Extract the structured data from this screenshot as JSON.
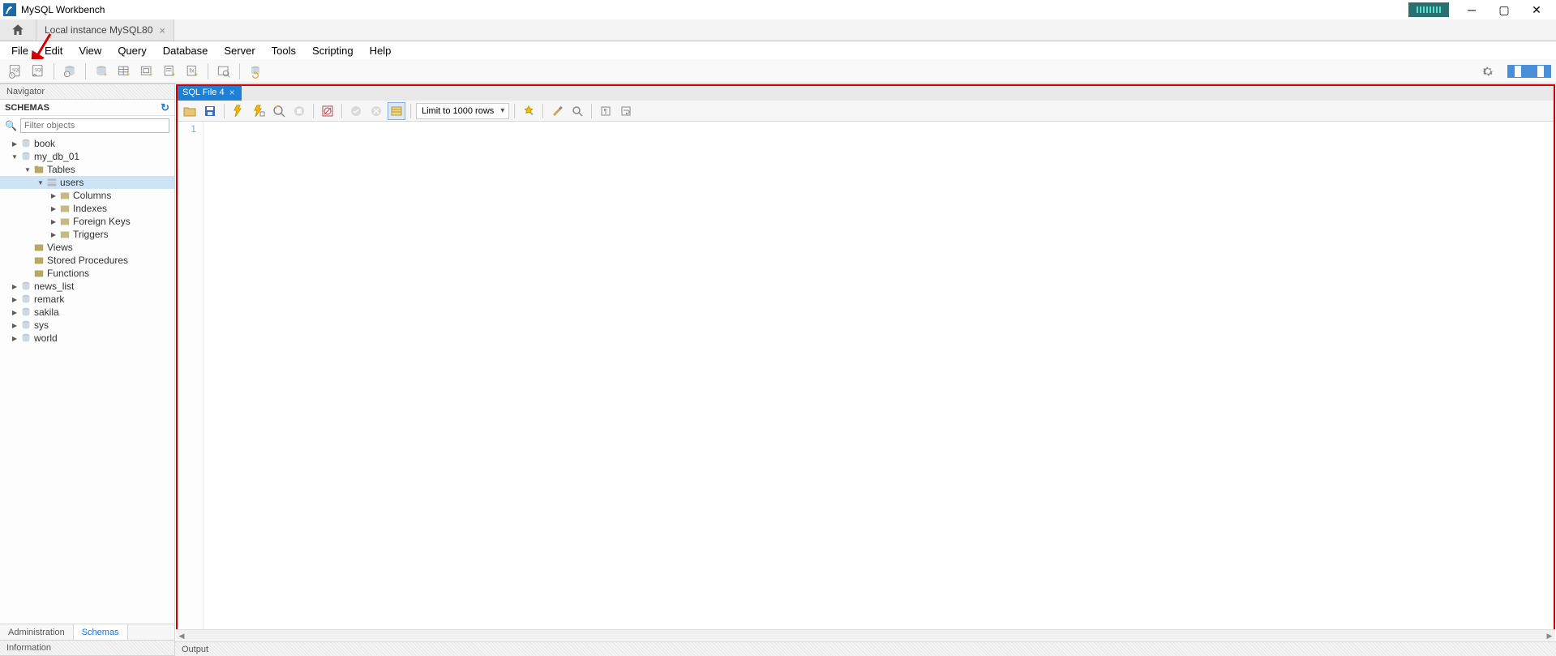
{
  "window": {
    "title": "MySQL Workbench"
  },
  "connection_tab": {
    "label": "Local instance MySQL80"
  },
  "menu": {
    "items": [
      "File",
      "Edit",
      "View",
      "Query",
      "Database",
      "Server",
      "Tools",
      "Scripting",
      "Help"
    ]
  },
  "navigator": {
    "panel_title": "Navigator",
    "schemas_label": "SCHEMAS",
    "filter_placeholder": "Filter objects",
    "tabs": {
      "admin": "Administration",
      "schemas": "Schemas"
    },
    "info_panel": "Information",
    "tree": {
      "book": "book",
      "my_db_01": "my_db_01",
      "tables": "Tables",
      "users": "users",
      "columns": "Columns",
      "indexes": "Indexes",
      "fkeys": "Foreign Keys",
      "triggers": "Triggers",
      "views": "Views",
      "sprocs": "Stored Procedures",
      "functions": "Functions",
      "news_list": "news_list",
      "remark": "remark",
      "sakila": "sakila",
      "sys": "sys",
      "world": "world"
    }
  },
  "editor": {
    "tab_label": "SQL File 4",
    "limit_label": "Limit to 1000 rows",
    "line_1": "1"
  },
  "output": {
    "label": "Output"
  }
}
